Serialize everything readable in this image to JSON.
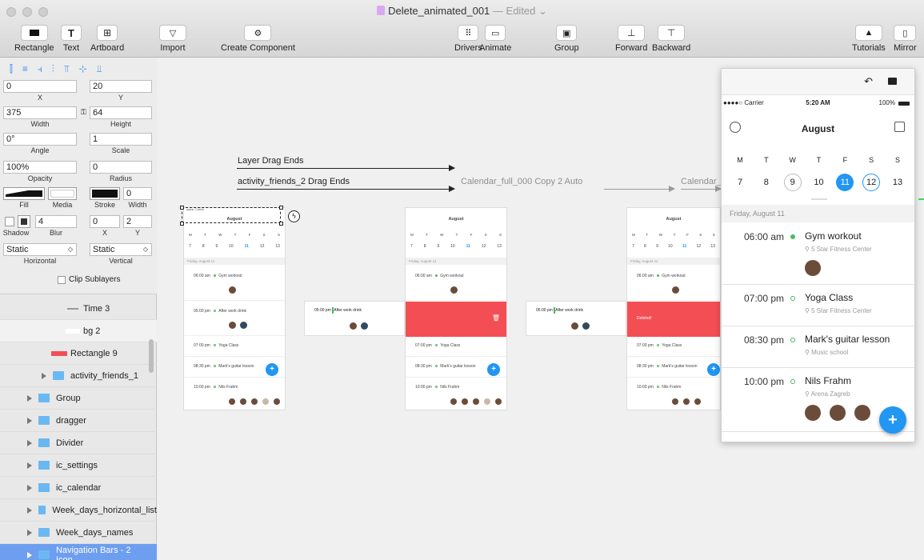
{
  "window": {
    "title": "Delete_animated_001",
    "edited": "— Edited"
  },
  "toolbar": {
    "rectangle": "Rectangle",
    "text": "Text",
    "artboard": "Artboard",
    "import": "Import",
    "create_component": "Create Component",
    "drivers": "Drivers",
    "animate": "Animate",
    "group": "Group",
    "forward": "Forward",
    "backward": "Backward",
    "tutorials": "Tutorials",
    "mirror": "Mirror"
  },
  "inspector": {
    "x": {
      "value": "0",
      "label": "X"
    },
    "y": {
      "value": "20",
      "label": "Y"
    },
    "width": {
      "value": "375",
      "label": "Width"
    },
    "height": {
      "value": "64",
      "label": "Height"
    },
    "angle": {
      "value": "0°",
      "label": "Angle"
    },
    "scale": {
      "value": "1",
      "label": "Scale"
    },
    "opacity": {
      "value": "100%",
      "label": "Opacity"
    },
    "radius": {
      "value": "0",
      "label": "Radius"
    },
    "fill_label": "Fill",
    "media_label": "Media",
    "stroke_label": "Stroke",
    "stroke_width": {
      "value": "0",
      "label": "Width"
    },
    "shadow_label": "Shadow",
    "blur": {
      "value": "4",
      "label": "Blur"
    },
    "shadow_x": {
      "value": "0",
      "label": "X"
    },
    "shadow_y": {
      "value": "2",
      "label": "Y"
    },
    "horizontal": {
      "value": "Static",
      "label": "Horizontal"
    },
    "vertical": {
      "value": "Static",
      "label": "Vertical"
    },
    "clip_sublayers": "Clip Sublayers"
  },
  "layers": [
    {
      "name": "Time 3",
      "type": "text",
      "indent": 104
    },
    {
      "name": "bg 2",
      "type": "white",
      "indent": 104
    },
    {
      "name": "Rectangle 9",
      "type": "rect",
      "indent": 88
    },
    {
      "name": "activity_friends_1",
      "type": "folder",
      "indent": 52
    },
    {
      "name": "Group",
      "type": "folder",
      "indent": 34
    },
    {
      "name": "dragger",
      "type": "folder",
      "indent": 34
    },
    {
      "name": "Divider",
      "type": "folder",
      "indent": 34
    },
    {
      "name": "ic_settings",
      "type": "folder",
      "indent": 34
    },
    {
      "name": "ic_calendar",
      "type": "folder",
      "indent": 34
    },
    {
      "name": "Week_days_horizontal_list",
      "type": "folder",
      "indent": 34
    },
    {
      "name": "Week_days_names",
      "type": "folder",
      "indent": 34
    },
    {
      "name": "Navigation Bars - 2 Icon...",
      "type": "folder",
      "indent": 34,
      "selected": true
    }
  ],
  "canvas": {
    "transition_1": "Layer Drag Ends",
    "transition_2": "activity_friends_2 Drag Ends",
    "transition_3": "Calendar_full_000 Copy 2 Auto",
    "transition_4": "Calendar_",
    "deleted_label": "Deleted!",
    "mini_month": "August",
    "mini_day_header": "Friday, August 11"
  },
  "preview": {
    "carrier": "●●●●○ Carrier",
    "time": "5:20 AM",
    "battery": "100%",
    "month": "August",
    "weekdays": [
      "M",
      "T",
      "W",
      "T",
      "F",
      "S",
      "S"
    ],
    "dates": [
      "7",
      "8",
      "9",
      "10",
      "11",
      "12",
      "13"
    ],
    "day_header": "Friday, August 11",
    "events": [
      {
        "time": "06:00 am",
        "name": "Gym workout",
        "location": "5 Star Fitness Center",
        "avatars": 1,
        "dot": "filled"
      },
      {
        "time": "07:00 pm",
        "name": "Yoga Class",
        "location": "5 Star Fitness Center",
        "avatars": 0,
        "dot": "hollow"
      },
      {
        "time": "08:30 pm",
        "name": "Mark's guitar lesson",
        "location": "Music school",
        "avatars": 0,
        "dot": "hollow"
      },
      {
        "time": "10:00 pm",
        "name": "Nils Frahm",
        "location": "Arena Zagreb",
        "avatars": 3,
        "dot": "hollow"
      }
    ]
  },
  "colors": {
    "accent": "#2196f3",
    "green": "#4cb963",
    "delete_red": "#f44e55",
    "selection": "#6d9ef0"
  }
}
